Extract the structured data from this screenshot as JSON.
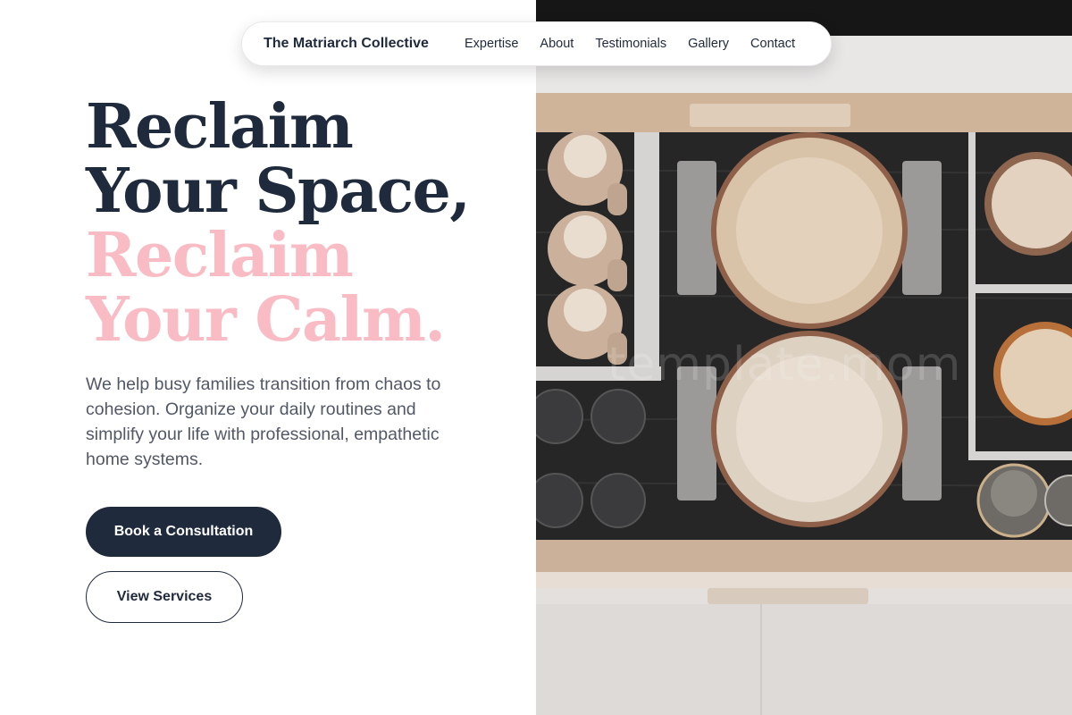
{
  "nav": {
    "brand": "The Matriarch Collective",
    "links": [
      "Expertise",
      "About",
      "Testimonials",
      "Gallery",
      "Contact"
    ]
  },
  "hero": {
    "headline_lines": [
      "Reclaim",
      "Your Space,",
      "Reclaim",
      "Your Calm."
    ],
    "subtext": "We help busy families transition from chaos to cohesion. Organize your daily routines and simplify your life with professional, empathetic home systems.",
    "primary_button": "Book a Consultation",
    "secondary_button": "View Services"
  },
  "image": {
    "subject": "organized-kitchen-drawer-photo",
    "watermark": "template.mom"
  },
  "colors": {
    "navy": "#1f2a3c",
    "pink": "#f9bcc5",
    "body_text": "#515866",
    "background": "#ffffff"
  }
}
